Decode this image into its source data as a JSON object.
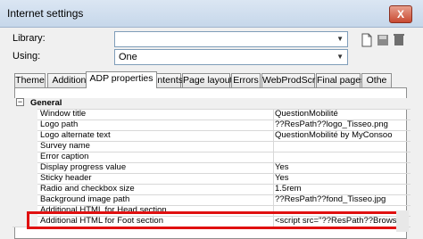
{
  "window": {
    "title": "Internet settings",
    "close_glyph": "X"
  },
  "library": {
    "label": "Library:",
    "value": ""
  },
  "using": {
    "label": "Using:",
    "value": "One"
  },
  "toolbar": {
    "icons": [
      "new-document-icon",
      "save-icon",
      "delete-icon"
    ]
  },
  "tabs": [
    {
      "label": "Theme"
    },
    {
      "label": "Additional"
    },
    {
      "label": "ADP properties",
      "active": true
    },
    {
      "label": "Contents"
    },
    {
      "label": "Page layout"
    },
    {
      "label": "Errors"
    },
    {
      "label": "WebProdScript"
    },
    {
      "label": "Final pages"
    },
    {
      "label": "Othe"
    }
  ],
  "group": {
    "label": "General",
    "toggle": "−"
  },
  "properties": [
    {
      "name": "Window title",
      "value": "QuestionMobilité"
    },
    {
      "name": "Logo path",
      "value": "??ResPath??logo_Tisseo.png"
    },
    {
      "name": "Logo alternate text",
      "value": "QuestionMobilité by MyConsoo"
    },
    {
      "name": "Survey name",
      "value": ""
    },
    {
      "name": "Error caption",
      "value": ""
    },
    {
      "name": "Display progress value",
      "value": "Yes"
    },
    {
      "name": "Sticky header",
      "value": "Yes"
    },
    {
      "name": "Radio and checkbox size",
      "value": "1.5rem"
    },
    {
      "name": "Background image path",
      "value": "??ResPath??fond_Tisseo.jpg"
    },
    {
      "name": "Additional HTML for Head section",
      "value": ""
    },
    {
      "name": "Additional HTML for Foot section",
      "value": "<script src=\"??ResPath??BrowseBy"
    }
  ]
}
